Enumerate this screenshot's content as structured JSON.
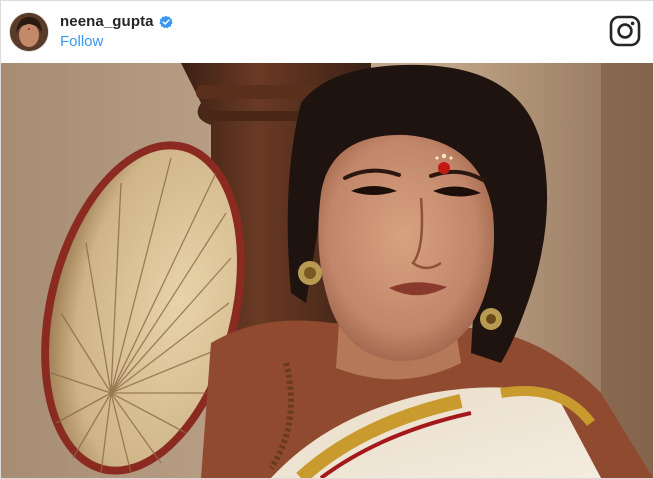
{
  "post": {
    "username": "neena_gupta",
    "verified": true,
    "follow_label": "Follow"
  },
  "icons": {
    "verified": "verified-badge-icon",
    "brand": "instagram-icon"
  },
  "colors": {
    "username": "#262626",
    "follow": "#3897f0",
    "verified": "#3897f0",
    "border": "#dbdbdb"
  }
}
